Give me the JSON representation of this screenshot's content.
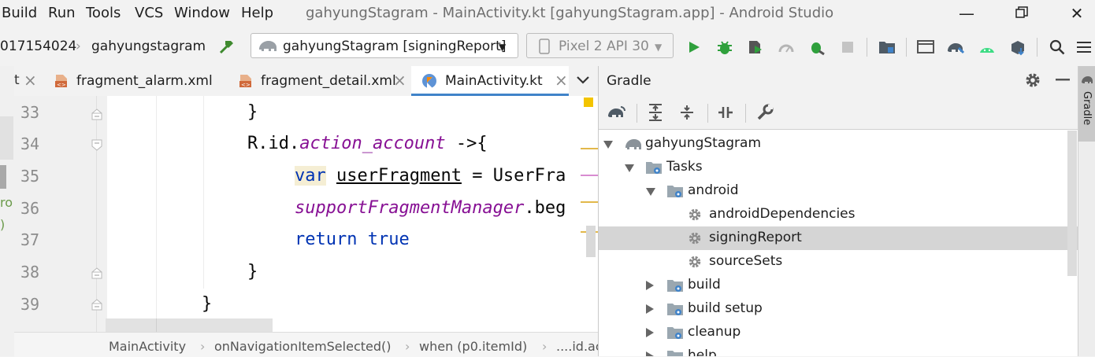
{
  "menu": [
    "Build",
    "Run",
    "Tools",
    "VCS",
    "Window",
    "Help"
  ],
  "window_title": "gahyungStagram - MainActivity.kt [gahyungStagram.app] - Android Studio",
  "toolbar": {
    "breadcrumb_partial": "017154024",
    "breadcrumb_project": "gahyungstagram",
    "run_config": "gahyungStagram [signingReport]",
    "device": "Pixel 2 API 30"
  },
  "tabs": [
    {
      "label": "fragment_alarm.xml"
    },
    {
      "label": "fragment_detail.xml"
    },
    {
      "label": "MainActivity.kt"
    }
  ],
  "editor": {
    "lines": [
      "33",
      "34",
      "35",
      "36",
      "37",
      "38",
      "39"
    ],
    "code": {
      "l33": "}",
      "l34_a": "R.id.",
      "l34_b": "action_account",
      "l34_c": " ->{",
      "l35_kw": "var",
      "l35_var": "userFragment",
      "l35_rest": " = UserFra",
      "l36_a": "supportFragmentManager",
      "l36_b": ".beg",
      "l37_kw1": "return",
      "l37_kw2": "true",
      "l38": "}",
      "l39": "}"
    },
    "left_clip": [
      "ro",
      ")"
    ]
  },
  "breadcrumbs": [
    "MainActivity",
    "onNavigationItemSelected()",
    "when (p0.itemId)",
    "....id.ac"
  ],
  "gradle": {
    "title": "Gradle",
    "stripe_label": "Gradle",
    "tree": {
      "root": "gahyungStagram",
      "tasks": "Tasks",
      "android": "android",
      "android_children": [
        "androidDependencies",
        "signingReport",
        "sourceSets"
      ],
      "groups": [
        "build",
        "build setup",
        "cleanup",
        "help"
      ]
    }
  },
  "colors": {
    "accent": "#4083c9",
    "keyword": "#0033b3",
    "italic": "#871094",
    "run_green": "#2fa03c"
  }
}
